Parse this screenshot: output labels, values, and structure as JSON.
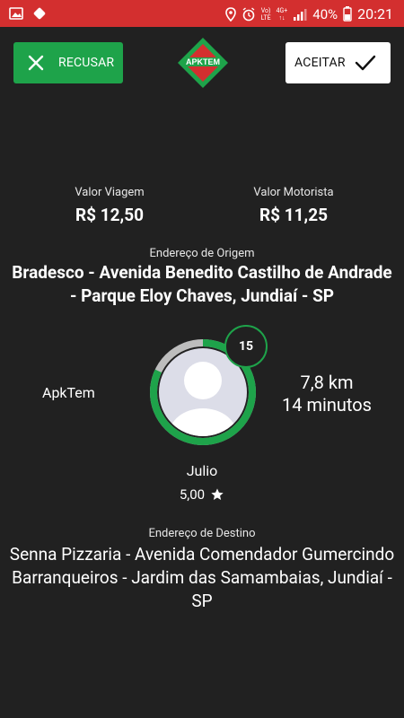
{
  "status_bar": {
    "battery": "40%",
    "time": "20:21",
    "network_top": "Vo)",
    "network_bottom": "LTE",
    "signal_label": "4G+"
  },
  "buttons": {
    "refuse_label": "RECUSAR",
    "accept_label": "ACEITAR"
  },
  "logo": {
    "text": "APKTEM"
  },
  "fares": {
    "trip_label": "Valor Viagem",
    "trip_value": "R$ 12,50",
    "driver_label": "Valor Motorista",
    "driver_value": "R$ 11,25"
  },
  "origin": {
    "label": "Endereço de Origem",
    "address": "Bradesco - Avenida Benedito Castilho de Andrade - Parque Eloy Chaves, Jundiaí - SP"
  },
  "request": {
    "company": "ApkTem",
    "countdown": "15",
    "distance": "7,8 km",
    "duration": "14 minutos",
    "timer_progress": 0.82
  },
  "driver": {
    "name": "Julio",
    "rating": "5,00"
  },
  "destination": {
    "label": "Endereço de Destino",
    "address": "Senna Pizzaria - Avenida Comendador Gumercindo Barranqueiros - Jardim das Samambaias, Jundiaí - SP"
  },
  "colors": {
    "status_bar": "#d32f2f",
    "accent_green": "#1ea34a",
    "background": "#212121"
  }
}
